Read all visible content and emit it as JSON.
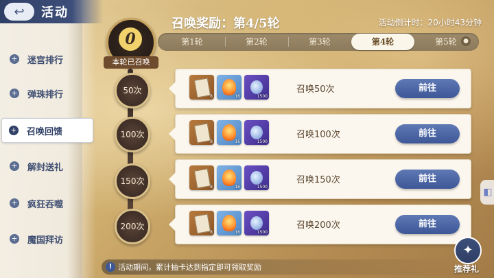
{
  "header": {
    "title": "活动",
    "back_icon": "back-arrow-icon"
  },
  "sidebar": {
    "items": [
      {
        "label": "迷宫排行",
        "active": false
      },
      {
        "label": "弹珠排行",
        "active": false
      },
      {
        "label": "召唤回馈",
        "active": true
      },
      {
        "label": "解封送礼",
        "active": false
      },
      {
        "label": "疯狂吞噬",
        "active": false
      },
      {
        "label": "魔国拜访",
        "active": false
      }
    ]
  },
  "main": {
    "reward_title": "召唤奖励：第4/5轮",
    "countdown": "活动倒计时：20小时43分钟",
    "tabs": [
      {
        "label": "第1轮",
        "active": false
      },
      {
        "label": "第2轮",
        "active": false
      },
      {
        "label": "第3轮",
        "active": false
      },
      {
        "label": "第4轮",
        "active": true
      },
      {
        "label": "第5轮",
        "active": false,
        "locked": true
      }
    ],
    "summoned_count": "0",
    "summoned_label": "本轮已召唤",
    "milestones": [
      "50次",
      "100次",
      "150次",
      "200次"
    ],
    "rows": [
      {
        "text": "召唤50次",
        "button": "前往",
        "items": [
          {
            "icon": "book-icon",
            "qty": "8"
          },
          {
            "icon": "fire-orb-icon",
            "qty": "16"
          },
          {
            "icon": "potion-icon",
            "qty": "1500"
          }
        ]
      },
      {
        "text": "召唤100次",
        "button": "前往",
        "items": [
          {
            "icon": "book-icon",
            "qty": "8"
          },
          {
            "icon": "fire-orb-icon",
            "qty": "16"
          },
          {
            "icon": "potion-icon",
            "qty": "1500"
          }
        ]
      },
      {
        "text": "召唤150次",
        "button": "前往",
        "items": [
          {
            "icon": "book-icon",
            "qty": "8"
          },
          {
            "icon": "fire-orb-icon",
            "qty": "16"
          },
          {
            "icon": "potion-icon",
            "qty": "1500"
          }
        ]
      },
      {
        "text": "召唤200次",
        "button": "前往",
        "items": [
          {
            "icon": "book-icon",
            "qty": "8"
          },
          {
            "icon": "fire-orb-icon",
            "qty": "16"
          },
          {
            "icon": "potion-icon",
            "qty": "1500"
          }
        ]
      }
    ]
  },
  "footer": {
    "tip": "活动期间，累计抽卡达到指定即可领取奖励"
  },
  "gift": {
    "label": "推荐礼"
  },
  "colors": {
    "accent": "#3d5797",
    "header": "#2f3f66",
    "panel": "#fbf7ee"
  }
}
